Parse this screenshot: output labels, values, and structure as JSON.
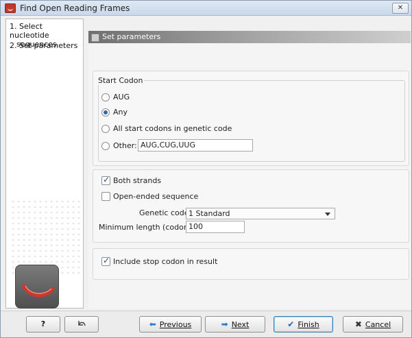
{
  "window": {
    "title": "Find Open Reading Frames"
  },
  "sidebar": {
    "steps": [
      {
        "number": "1.",
        "label_line1": "Select nucleotide",
        "label_line2": "sequences"
      },
      {
        "number": "2.",
        "label": "Set parameters"
      }
    ]
  },
  "main": {
    "header": "Set parameters",
    "start_codon": {
      "legend": "Start Codon",
      "options": [
        "AUG",
        "Any",
        "All start codons in genetic code",
        "Other:"
      ],
      "selected": "Any",
      "other_value": "AUG,CUG,UUG"
    },
    "strands": {
      "both_strands_label": "Both strands",
      "both_strands_checked": true,
      "open_ended_label": "Open-ended sequence",
      "open_ended_checked": false,
      "genetic_code_label": "Genetic code:",
      "genetic_code_value": "1 Standard",
      "min_length_label": "Minimum length (codons):",
      "min_length_value": "100"
    },
    "stop_codon": {
      "label": "Include stop codon in result",
      "checked": true
    }
  },
  "buttons": {
    "help": "?",
    "previous": "Previous",
    "next": "Next",
    "finish": "Finish",
    "cancel": "Cancel"
  },
  "icons": {
    "app": "clc-logo-icon",
    "close": "close-icon",
    "reset": "reset-arrow-icon",
    "previous": "left-arrow-icon",
    "next": "right-arrow-icon",
    "finish": "checkmark-icon",
    "cancel": "x-icon"
  },
  "colors": {
    "accent": "#2f66b0",
    "header": "#8a8a8a",
    "brand": "#c0392b"
  }
}
